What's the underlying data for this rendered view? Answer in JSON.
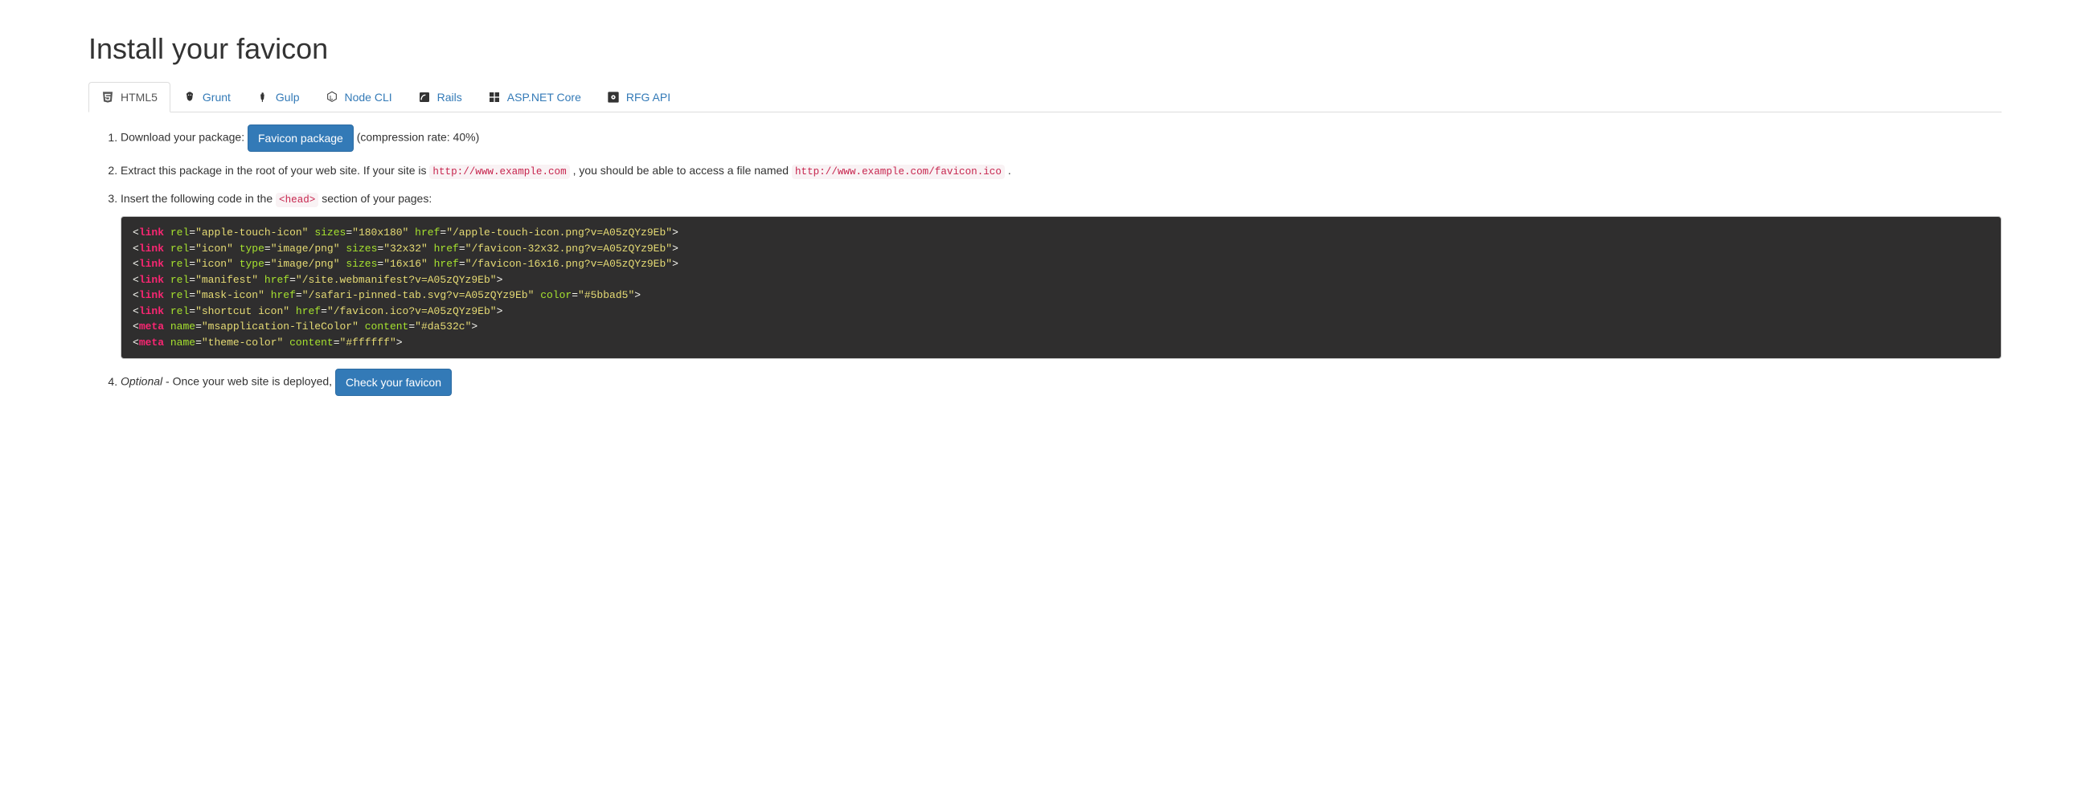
{
  "heading": "Install your favicon",
  "tabs": [
    {
      "label": "HTML5"
    },
    {
      "label": "Grunt"
    },
    {
      "label": "Gulp"
    },
    {
      "label": "Node CLI"
    },
    {
      "label": "Rails"
    },
    {
      "label": "ASP.NET Core"
    },
    {
      "label": "RFG API"
    }
  ],
  "step1": {
    "prefix": "Download your package: ",
    "button": "Favicon package",
    "suffix": " (compression rate: 40%)"
  },
  "step2": {
    "part1": "Extract this package in the root of your web site. If your site is ",
    "code1": "http://www.example.com",
    "part2": ", you should be able to access a file named ",
    "code2": "http://www.example.com/favicon.ico",
    "part3": "."
  },
  "step3": {
    "part1": "Insert the following code in the ",
    "code1": "<head>",
    "part2": " section of your pages:"
  },
  "code": {
    "lines": [
      {
        "tag": "link",
        "attrs": [
          [
            "rel",
            "apple-touch-icon"
          ],
          [
            "sizes",
            "180x180"
          ],
          [
            "href",
            "/apple-touch-icon.png?v=A05zQYz9Eb"
          ]
        ]
      },
      {
        "tag": "link",
        "attrs": [
          [
            "rel",
            "icon"
          ],
          [
            "type",
            "image/png"
          ],
          [
            "sizes",
            "32x32"
          ],
          [
            "href",
            "/favicon-32x32.png?v=A05zQYz9Eb"
          ]
        ]
      },
      {
        "tag": "link",
        "attrs": [
          [
            "rel",
            "icon"
          ],
          [
            "type",
            "image/png"
          ],
          [
            "sizes",
            "16x16"
          ],
          [
            "href",
            "/favicon-16x16.png?v=A05zQYz9Eb"
          ]
        ]
      },
      {
        "tag": "link",
        "attrs": [
          [
            "rel",
            "manifest"
          ],
          [
            "href",
            "/site.webmanifest?v=A05zQYz9Eb"
          ]
        ]
      },
      {
        "tag": "link",
        "attrs": [
          [
            "rel",
            "mask-icon"
          ],
          [
            "href",
            "/safari-pinned-tab.svg?v=A05zQYz9Eb"
          ],
          [
            "color",
            "#5bbad5"
          ]
        ]
      },
      {
        "tag": "link",
        "attrs": [
          [
            "rel",
            "shortcut icon"
          ],
          [
            "href",
            "/favicon.ico?v=A05zQYz9Eb"
          ]
        ]
      },
      {
        "tag": "meta",
        "attrs": [
          [
            "name",
            "msapplication-TileColor"
          ],
          [
            "content",
            "#da532c"
          ]
        ]
      },
      {
        "tag": "meta",
        "attrs": [
          [
            "name",
            "theme-color"
          ],
          [
            "content",
            "#ffffff"
          ]
        ]
      }
    ]
  },
  "step4": {
    "em": "Optional",
    "part1": " - Once your web site is deployed, ",
    "button": "Check your favicon"
  }
}
